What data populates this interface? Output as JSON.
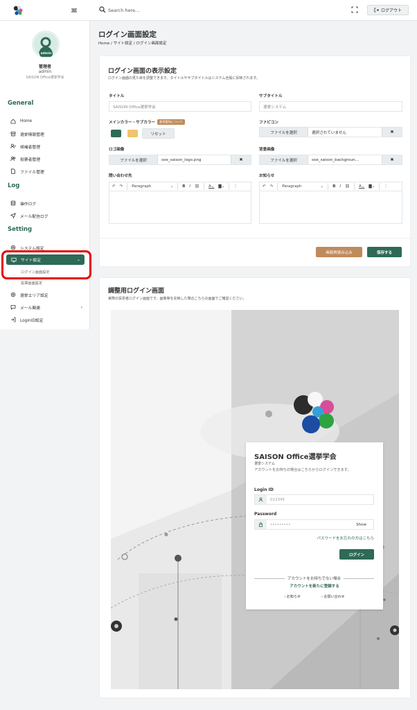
{
  "topbar": {
    "search_placeholder": "Search here...",
    "logout_label": "ログアウト"
  },
  "user": {
    "badge": "admin",
    "role": "管理者",
    "name": "admin",
    "org": "SAISON Office選挙学会"
  },
  "sidebar": {
    "sections": [
      {
        "title": "General",
        "items": [
          "Home",
          "選挙情報管理",
          "候補者管理",
          "投票者管理",
          "ファイル管理"
        ]
      },
      {
        "title": "Log",
        "items": [
          "操作ログ",
          "メール配信ログ"
        ]
      },
      {
        "title": "Setting",
        "items": [
          "システム設定",
          "サイト設定",
          "選挙エリア設定",
          "メール関連",
          "LoginID設定"
        ]
      }
    ],
    "sub_items": [
      "ログイン画面設定",
      "投票画面設定"
    ],
    "active": "サイト設定"
  },
  "page": {
    "title": "ログイン画面設定",
    "breadcrumb": [
      "Home",
      "サイト設定",
      "ログイン画面設定"
    ]
  },
  "display_settings": {
    "title": "ログイン画面の表示設定",
    "description": "ログイン画面の見た目を調整できます。タイトルやサブタイトルはシステム全般に反映されます。",
    "title_label": "タイトル",
    "title_value": "SAISON Office選挙学会",
    "subtitle_label": "サブタイトル",
    "subtitle_value": "選挙システム",
    "color_label": "メインカラー・サブカラー",
    "color_tag": "使用箇所について",
    "main_color": "#2e6a55",
    "sub_color": "#f0c36d",
    "reset_label": "リセット",
    "favicon_label": "ファビコン",
    "file_select": "ファイルを選択",
    "favicon_value": "選択されていません",
    "logo_label": "ロゴ画像",
    "logo_value": "soe_saison_logo.png",
    "bg_label": "背景画像",
    "bg_value": "soe_saison_backgroun...",
    "contact_label": "問い合わせ先",
    "notice_label": "お知らせ",
    "editor_paragraph": "Paragraph",
    "reload_label": "画面再読み込み",
    "save_label": "保存する"
  },
  "preview": {
    "title": "調整用ログイン画面",
    "description": "実際の投票者ログイン画面です。画像等を反映した場合こちらの画面でご確認ください。",
    "login": {
      "title": "SAISON Office選挙学会",
      "subtitle": "選挙システム",
      "note": "アカウントをお持ちの場合はこちらからログインできます。",
      "id_label": "Login ID",
      "id_placeholder": "012345",
      "pw_label": "Password",
      "pw_value": "•••••••••",
      "show_label": "Show",
      "forgot": "パスワードをお忘れの方はこちら",
      "login_btn": "ログイン",
      "no_account": "アカウントをお持ちでない場合",
      "register": "アカウントを新たに登録する",
      "notice_link": "› お知らせ",
      "contact_link": "› お問い合わせ"
    }
  }
}
